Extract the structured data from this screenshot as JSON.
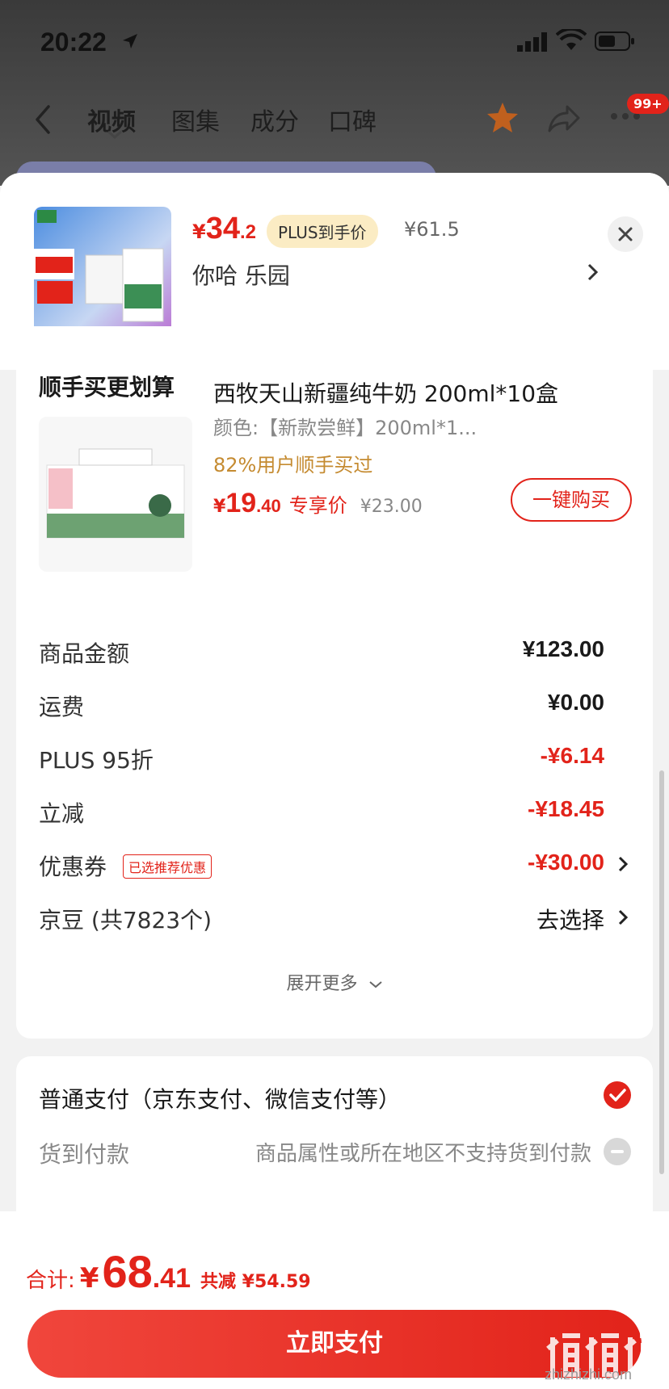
{
  "status": {
    "time": "20:22"
  },
  "nav": {
    "tabs": [
      "视频",
      "图集",
      "成分",
      "口碑"
    ],
    "badge": "99+"
  },
  "product": {
    "price_yen": "¥",
    "price_int": "34",
    "price_dec": ".2",
    "plus_tag": "PLUS到手价",
    "orig_price": "¥61.5",
    "spec": "你哈  乐园"
  },
  "extra_buy": {
    "title": "顺手买更划算",
    "item_title": "西牧天山新疆纯牛奶 200ml*10盒",
    "item_spec": "颜色:【新款尝鲜】200ml*1...",
    "bought": "82%用户顺手买过",
    "price_yen": "¥",
    "price_int": "19",
    "price_dec": ".40",
    "price_label": "专享价",
    "old_price": "¥23.00",
    "buy_button": "一键购买"
  },
  "summary": {
    "rows": [
      {
        "label": "商品金额",
        "value": "¥123.00"
      },
      {
        "label": "运费",
        "value": "¥0.00"
      },
      {
        "label": "PLUS 95折",
        "value": "-¥6.14"
      },
      {
        "label": "立减",
        "value": "-¥18.45"
      },
      {
        "label": "优惠券",
        "value": "-¥30.00",
        "tag": "已选推荐优惠"
      },
      {
        "label": "京豆 (共7823个)",
        "value": "去选择"
      }
    ],
    "expand": "展开更多"
  },
  "payment": {
    "normal": "普通支付（京东支付、微信支付等）",
    "cod": "货到付款",
    "cod_note": "商品属性或所在地区不支持货到付款"
  },
  "bottom": {
    "total_label": "合计:",
    "total_yen": "¥",
    "total_int": "68",
    "total_dec": ".41",
    "saved": "共减 ¥54.59",
    "pay_button": "立即支付",
    "watermark_text": "zhizhizhi.com"
  },
  "colors": {
    "accent": "#e2231a",
    "gold": "#c58b31",
    "plus_tag_bg": "#fbecc4"
  },
  "icons": [
    "location-arrow-icon",
    "signal-icon",
    "wifi-icon",
    "battery-icon",
    "back-icon",
    "star-icon",
    "share-icon",
    "more-icon",
    "close-icon",
    "chevron-right-icon",
    "check-icon",
    "minus-icon",
    "chevron-down-icon"
  ]
}
